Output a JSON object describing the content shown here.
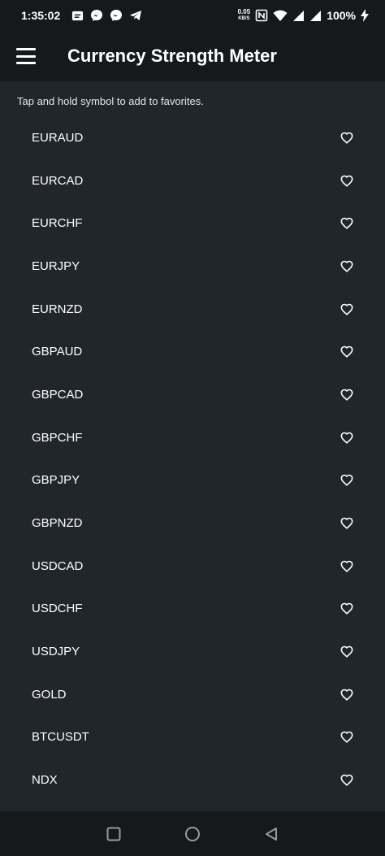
{
  "status_bar": {
    "time": "1:35:02",
    "net_speed_value": "0.05",
    "net_speed_unit": "KB/S",
    "battery": "100%"
  },
  "app_bar": {
    "title": "Currency Strength Meter"
  },
  "hint": "Tap and hold symbol to add to favorites.",
  "symbols": [
    {
      "name": "EURAUD"
    },
    {
      "name": "EURCAD"
    },
    {
      "name": "EURCHF"
    },
    {
      "name": "EURJPY"
    },
    {
      "name": "EURNZD"
    },
    {
      "name": "GBPAUD"
    },
    {
      "name": "GBPCAD"
    },
    {
      "name": "GBPCHF"
    },
    {
      "name": "GBPJPY"
    },
    {
      "name": "GBPNZD"
    },
    {
      "name": "USDCAD"
    },
    {
      "name": "USDCHF"
    },
    {
      "name": "USDJPY"
    },
    {
      "name": "GOLD"
    },
    {
      "name": "BTCUSDT"
    },
    {
      "name": "NDX"
    }
  ],
  "colors": {
    "background": "#21262b",
    "bar": "#16191c",
    "text": "#ffffff"
  }
}
